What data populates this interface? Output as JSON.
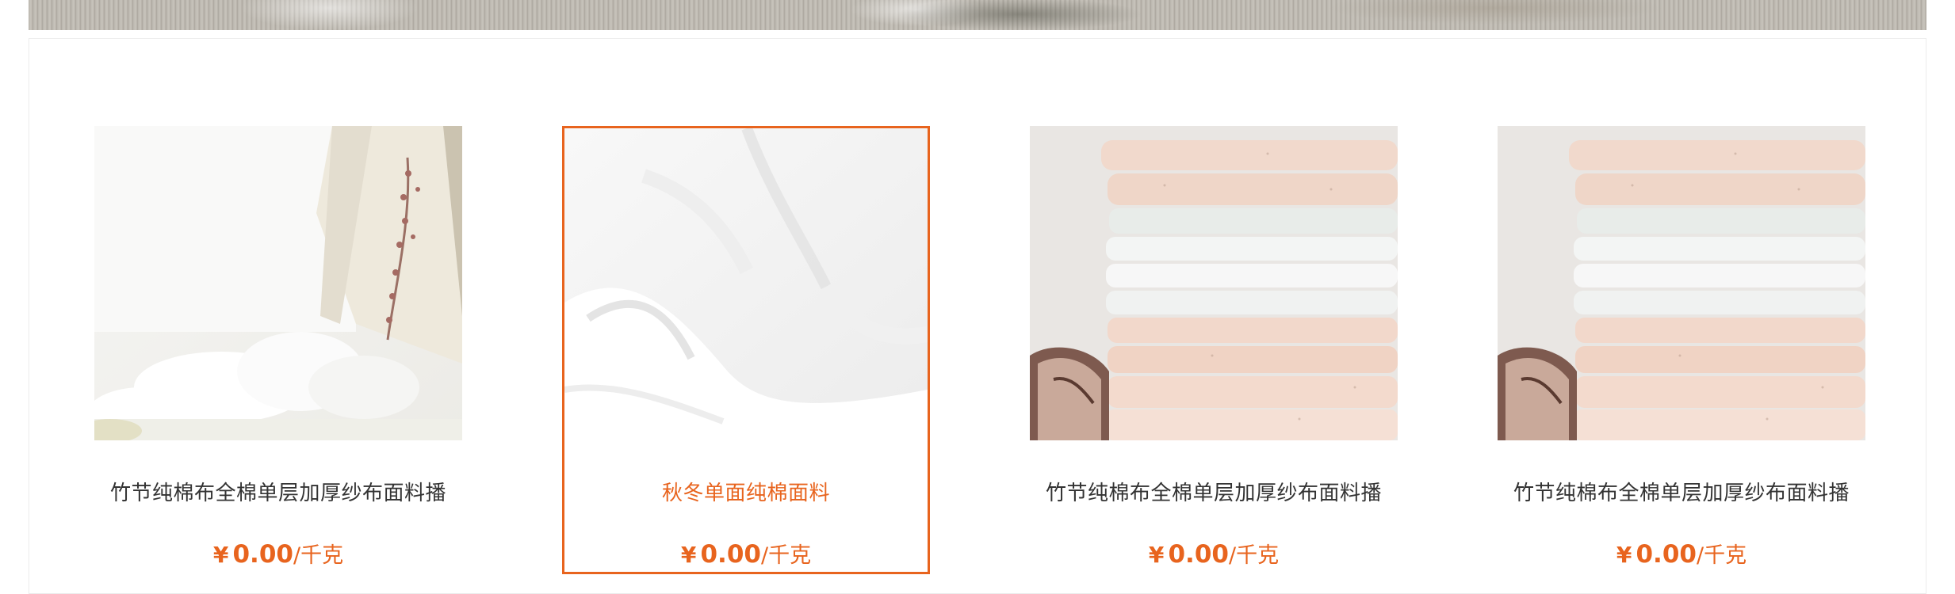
{
  "products": [
    {
      "title": "竹节纯棉布全棉单层加厚纱布面料播",
      "currency": "¥",
      "price": "0.00",
      "unit": "/千克",
      "image": "towel-curtain-photo",
      "selected": false
    },
    {
      "title": "秋冬单面纯棉面料",
      "currency": "¥",
      "price": "0.00",
      "unit": "/千克",
      "image": "white-fabric-photo",
      "selected": true
    },
    {
      "title": "竹节纯棉布全棉单层加厚纱布面料播",
      "currency": "¥",
      "price": "0.00",
      "unit": "/千克",
      "image": "folded-fabric-stack-photo",
      "selected": false
    },
    {
      "title": "竹节纯棉布全棉单层加厚纱布面料播",
      "currency": "¥",
      "price": "0.00",
      "unit": "/千克",
      "image": "folded-fabric-stack-photo",
      "selected": false
    }
  ],
  "colors": {
    "accent": "#e8641e",
    "text": "#333333",
    "border": "#ececec"
  }
}
